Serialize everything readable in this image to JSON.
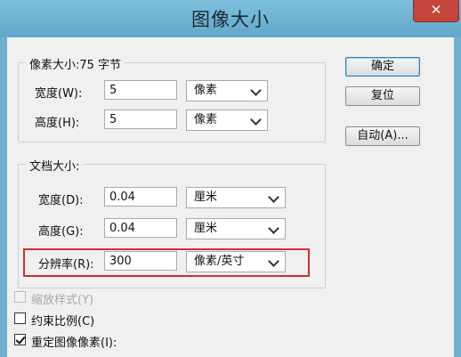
{
  "window": {
    "title": "图像大小",
    "close_symbol": "✕"
  },
  "pixel_dimensions": {
    "legend": "像素大小:75 字节",
    "width": {
      "label": "宽度(W):",
      "value": "5",
      "unit": "像素"
    },
    "height": {
      "label": "高度(H):",
      "value": "5",
      "unit": "像素"
    }
  },
  "document_size": {
    "legend": "文档大小:",
    "width": {
      "label": "宽度(D):",
      "value": "0.04",
      "unit": "厘米"
    },
    "height": {
      "label": "高度(G):",
      "value": "0.04",
      "unit": "厘米"
    },
    "resolution": {
      "label": "分辨率(R):",
      "value": "300",
      "unit": "像素/英寸"
    }
  },
  "buttons": {
    "ok": "确定",
    "reset": "复位",
    "auto": "自动(A)..."
  },
  "options": {
    "scale_styles": {
      "label": "缩放样式(Y)",
      "checked": false,
      "disabled": true
    },
    "constrain_proportions": {
      "label": "约束比例(C)",
      "checked": false
    },
    "resample_image": {
      "label": "重定图像像素(I):",
      "checked": true
    }
  },
  "colors": {
    "highlight_box": "#d62d2d",
    "title_bar": "#6fb0cf",
    "dialog_bg": "#f0f0f0"
  }
}
